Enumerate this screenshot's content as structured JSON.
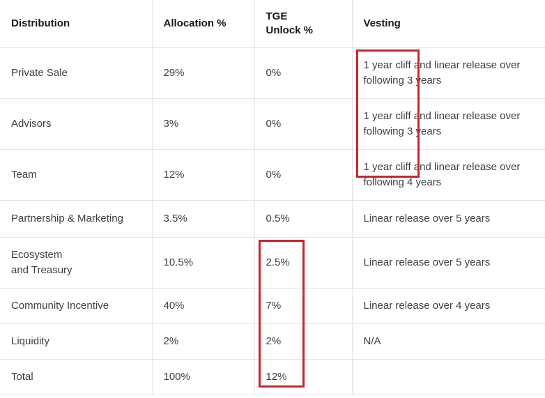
{
  "table": {
    "columns": [
      {
        "key": "distribution",
        "label": "Distribution"
      },
      {
        "key": "allocation",
        "label": "Allocation %"
      },
      {
        "key": "tge",
        "label": "TGE\nUnlock %"
      },
      {
        "key": "vesting",
        "label": "Vesting"
      }
    ],
    "rows": [
      {
        "distribution": "Private Sale",
        "allocation": "29%",
        "tge": "0%",
        "vesting": "1 year cliff and linear release over following 3 years"
      },
      {
        "distribution": "Advisors",
        "allocation": "3%",
        "tge": "0%",
        "vesting": "1 year cliff and linear release over following 3 years"
      },
      {
        "distribution": "Team",
        "allocation": "12%",
        "tge": "0%",
        "vesting": "1 year cliff and linear release over following 4 years"
      },
      {
        "distribution": "Partnership & Marketing",
        "allocation": "3.5%",
        "tge": "0.5%",
        "vesting": "Linear release over 5 years"
      },
      {
        "distribution": "Ecosystem\nand Treasury",
        "allocation": "10.5%",
        "tge": "2.5%",
        "vesting": "Linear release over 5 years"
      },
      {
        "distribution": "Community Incentive",
        "allocation": "40%",
        "tge": "7%",
        "vesting": "Linear release over 4 years"
      },
      {
        "distribution": "Liquidity",
        "allocation": "2%",
        "tge": "2%",
        "vesting": "N/A"
      },
      {
        "distribution": "Total",
        "allocation": "100%",
        "tge": "12%",
        "vesting": ""
      }
    ]
  },
  "annotations": [
    {
      "name": "vesting-cliff-highlight",
      "color": "#c9252d"
    },
    {
      "name": "tge-unlock-highlight",
      "color": "#c9252d"
    }
  ],
  "colors": {
    "annotation_red": "#c9252d",
    "header_text": "#17181a",
    "body_text": "#3c4043",
    "grid_line": "#e3e5e8",
    "background": "#ffffff"
  }
}
